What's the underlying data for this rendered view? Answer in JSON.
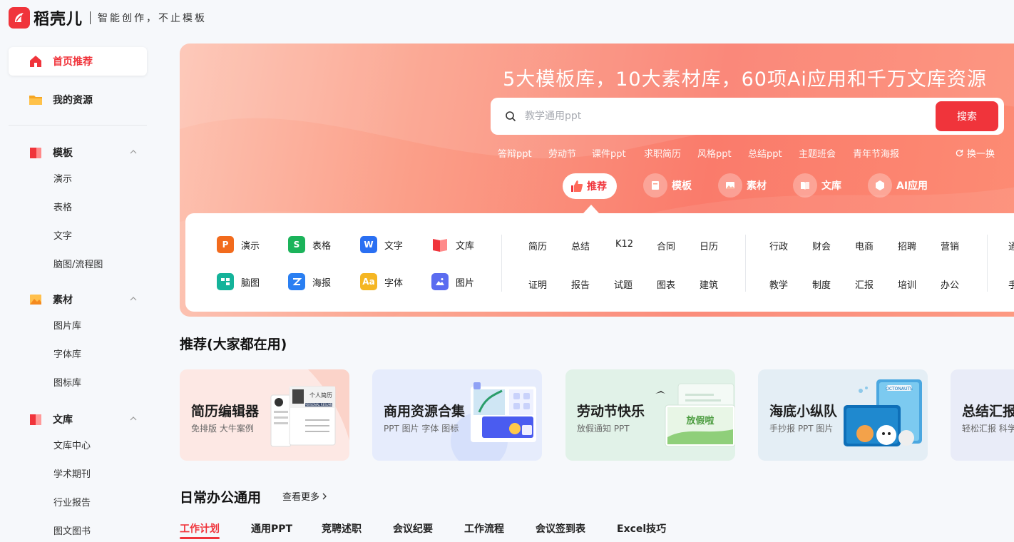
{
  "brand": {
    "name": "稻壳儿",
    "slogan": "智能创作，不止模板",
    "accent": "#f0343b"
  },
  "sidebar": {
    "home": "首页推荐",
    "resources": "我的资源",
    "groups": [
      {
        "label": "模板",
        "icon": "template-icon",
        "items": [
          "演示",
          "表格",
          "文字",
          "脑图/流程图"
        ]
      },
      {
        "label": "素材",
        "icon": "material-icon",
        "items": [
          "图片库",
          "字体库",
          "图标库"
        ]
      },
      {
        "label": "文库",
        "icon": "library-icon",
        "items": [
          "文库中心",
          "学术期刊",
          "行业报告",
          "图文图书"
        ]
      }
    ]
  },
  "hero": {
    "title": "5大模板库，10大素材库，60项Ai应用和千万文库资源",
    "search_placeholder": "教学通用ppt",
    "search_button": "搜索",
    "hot_words": [
      "答辩ppt",
      "劳动节",
      "课件ppt",
      "求职简历",
      "风格ppt",
      "总结ppt",
      "主题班会",
      "青年节海报"
    ],
    "refresh": "换一换",
    "tabs": [
      "推荐",
      "模板",
      "素材",
      "文库",
      "AI应用"
    ]
  },
  "apps": [
    {
      "label": "演示",
      "icon": "presentation-icon",
      "color": "#f26b1d",
      "glyph": "P"
    },
    {
      "label": "表格",
      "icon": "spreadsheet-icon",
      "color": "#1bb35a",
      "glyph": "S"
    },
    {
      "label": "文字",
      "icon": "writer-icon",
      "color": "#2a6ff2",
      "glyph": "W"
    },
    {
      "label": "文库",
      "icon": "library-book-icon",
      "color": "#f0343b",
      "glyph": ""
    },
    {
      "label": "脑图",
      "icon": "mindmap-icon",
      "color": "#14b39a",
      "glyph": ""
    },
    {
      "label": "海报",
      "icon": "poster-icon",
      "color": "#2a7ff2",
      "glyph": ""
    },
    {
      "label": "字体",
      "icon": "font-icon",
      "color": "#f5b623",
      "glyph": "Aa"
    },
    {
      "label": "图片",
      "icon": "image-icon",
      "color": "#5b6cf0",
      "glyph": ""
    }
  ],
  "keywords_a": [
    "简历",
    "总结",
    "K12",
    "合同",
    "日历",
    "证明",
    "报告",
    "试题",
    "图表",
    "建筑"
  ],
  "keywords_b": [
    "行政",
    "财会",
    "电商",
    "招聘",
    "营销",
    "教学",
    "制度",
    "汇报",
    "培训",
    "办公"
  ],
  "keywords_c": [
    "通",
    "手"
  ],
  "recommend": {
    "title": "推荐(大家都在用)",
    "cards": [
      {
        "title": "简历编辑器",
        "sub": "免排版 大牛案例",
        "bg": "#fde8e4"
      },
      {
        "title": "商用资源合集",
        "sub": "PPT 图片 字体 图标",
        "bg": "#e6ecfc"
      },
      {
        "title": "劳动节快乐",
        "sub": "放假通知 PPT",
        "bg": "#e1f2e8"
      },
      {
        "title": "海底小纵队",
        "sub": "手抄报 PPT 图片",
        "bg": "#e4eef5"
      },
      {
        "title": "总结汇报",
        "sub": "轻松汇报 科学",
        "bg": "#e9ecf8"
      }
    ]
  },
  "daily": {
    "title": "日常办公通用",
    "more": "查看更多",
    "tabs": [
      "工作计划",
      "通用PPT",
      "竞聘述职",
      "会议纪要",
      "工作流程",
      "会议签到表",
      "Excel技巧"
    ]
  }
}
